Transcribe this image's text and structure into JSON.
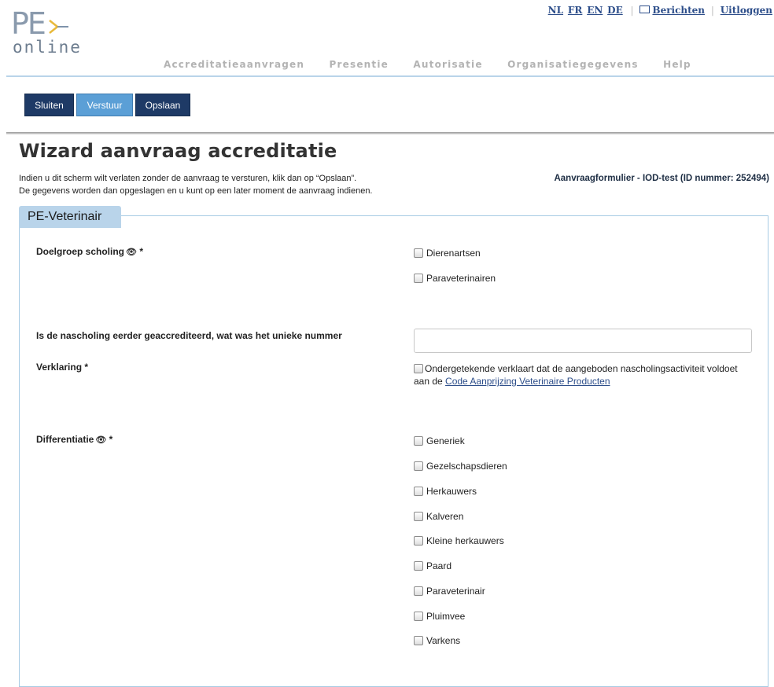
{
  "logo": {
    "line1": "PE",
    "line2": "online"
  },
  "top_links": {
    "languages": [
      "NL",
      "FR",
      "EN",
      "DE"
    ],
    "messages": "Berichten",
    "logout": "Uitloggen"
  },
  "nav": [
    "Accreditatieaanvragen",
    "Presentie",
    "Autorisatie",
    "Organisatiegegevens",
    "Help"
  ],
  "toolbar": {
    "close": "Sluiten",
    "submit": "Verstuur",
    "save": "Opslaan"
  },
  "page": {
    "title": "Wizard aanvraag accreditatie",
    "intro_line1": "Indien u dit scherm wilt verlaten zonder de aanvraag te versturen, klik dan op “Opslaan”.",
    "intro_line2": "De gegevens worden dan opgeslagen en u kunt op een later moment de aanvraag indienen.",
    "form_id": "Aanvraagformulier - IOD-test (ID nummer: 252494)"
  },
  "fieldset": {
    "legend": "PE-Veterinair",
    "doelgroep": {
      "label": "Doelgroep scholing",
      "required": "*",
      "options": [
        "Dierenartsen",
        "Paraveterinairen"
      ]
    },
    "nummer": {
      "label": "Is de nascholing eerder geaccrediteerd, wat was het unieke nummer",
      "value": ""
    },
    "verklaring": {
      "label": "Verklaring *",
      "text": "Ondergetekende verklaart dat de aangeboden nascholingsactiviteit voldoet aan de ",
      "link": "Code Aanprijzing Veterinaire Producten"
    },
    "differentiatie": {
      "label": "Differentiatie",
      "required": "*",
      "options": [
        "Generiek",
        "Gezelschapsdieren",
        "Herkauwers",
        "Kalveren",
        "Kleine herkauwers",
        "Paard",
        "Paraveterinair",
        "Pluimvee",
        "Varkens"
      ]
    }
  },
  "colors": {
    "nav_blue": "#1e3a66",
    "accent_blue": "#5b9fd6",
    "legend_bg": "#b9d4ea"
  }
}
